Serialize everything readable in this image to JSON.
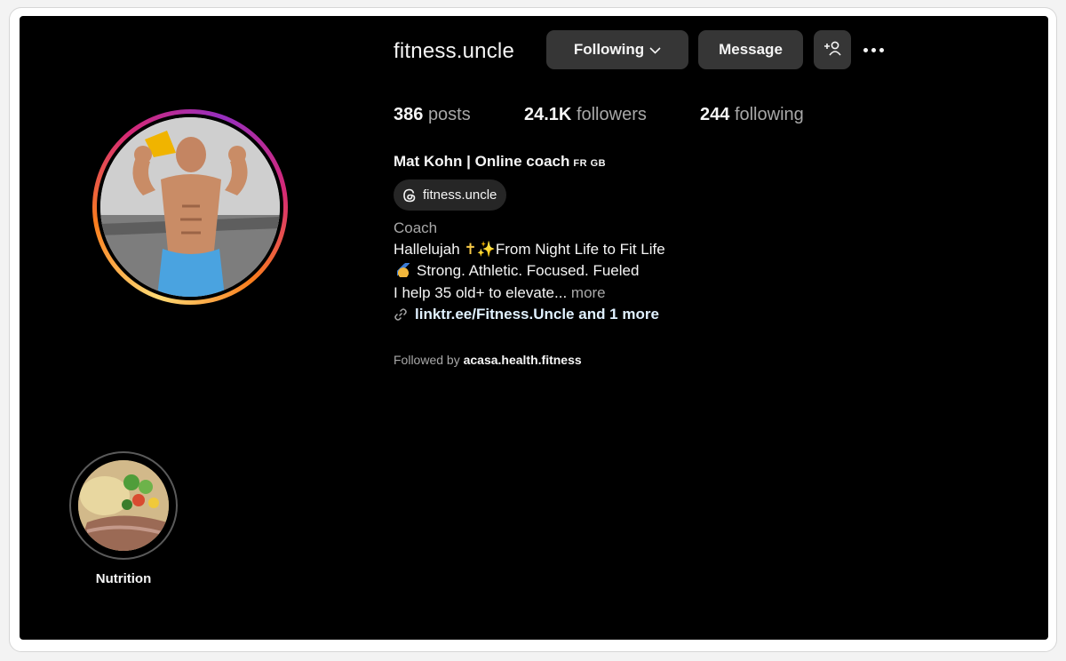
{
  "profile": {
    "username": "fitness.uncle",
    "buttons": {
      "following": "Following",
      "message": "Message"
    },
    "stats": {
      "posts_count": "386",
      "posts_label": "posts",
      "followers_count": "24.1K",
      "followers_label": "followers",
      "following_count": "244",
      "following_label": "following"
    },
    "full_name": "Mat Kohn | Online coach",
    "flags": "FR GB",
    "threads_handle": "fitness.uncle",
    "category": "Coach",
    "bio": {
      "line1_a": "Hallelujah",
      "line1_b": "From Night Life to Fit Life",
      "line2": "Strong. Athletic. Focused. Fueled",
      "line3": "I help 35 old+ to elevate...",
      "more": "more"
    },
    "link": "linktr.ee/Fitness.Uncle and 1 more",
    "followed_by_label": "Followed by",
    "followed_by_user": "acasa.health.fitness"
  },
  "highlights": [
    {
      "label": "Nutrition"
    }
  ],
  "colors": {
    "background": "#000000",
    "button": "#363636",
    "text": "#f5f5f5",
    "muted": "#a8a8a8",
    "link": "#e0f1ff"
  },
  "icons": [
    "chevron-down-icon",
    "add-user-icon",
    "more-options-icon",
    "threads-icon",
    "link-icon",
    "medal-icon",
    "sparkle-icon"
  ]
}
